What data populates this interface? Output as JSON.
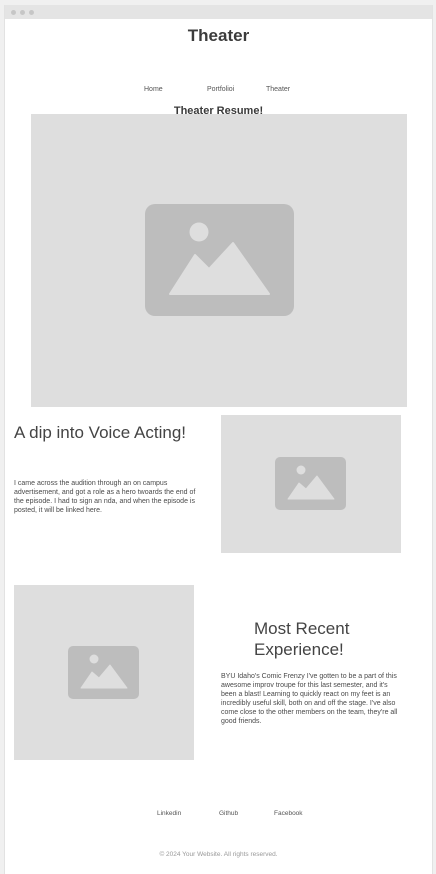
{
  "header": {
    "site_title": "Theater",
    "nav": [
      "Home",
      "Portfolioi",
      "Theater"
    ]
  },
  "main": {
    "page_heading": "Theater Resume!",
    "sections": [
      {
        "title": "A dip into Voice Acting!",
        "body": "I came across the audition through an on campus advertisement, and got a role as a hero twoards the end of the episode. I had to sign an nda, and when the episode is posted, it will be linked here."
      },
      {
        "title": "Most Recent Experience!",
        "body": "BYU Idaho's Comic Frenzy I've gotten to be a part of this awesome improv troupe for this last semester, and it's been a blast! Learning to quickly react on my feet is an incredibly useful skill, both on and off the stage. I've also come close to the other members on the team, they're all good friends."
      }
    ]
  },
  "footer": {
    "links": [
      "Linkedin",
      "Github",
      "Facebook"
    ],
    "copyright": "© 2024 Your Website. All rights reserved."
  },
  "colors": {
    "placeholder_bg": "#dedede",
    "placeholder_icon": "#bdbdbd"
  }
}
